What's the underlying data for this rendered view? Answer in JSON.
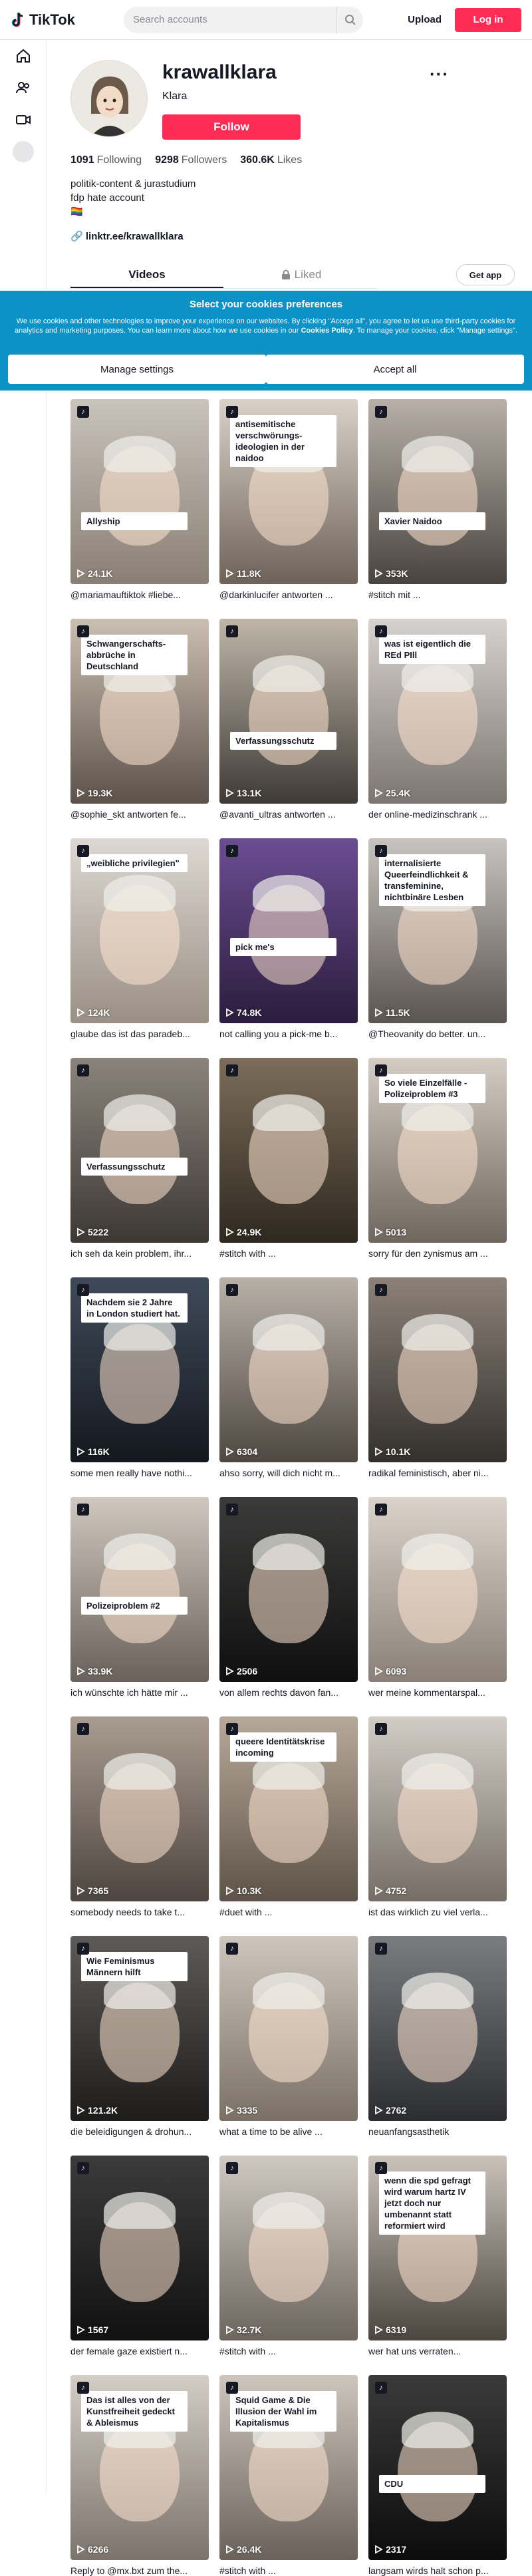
{
  "header": {
    "logo_text": "TikTok",
    "search_placeholder": "Search accounts",
    "upload_label": "Upload",
    "login_label": "Log in",
    "accent_color": "#fe2c55"
  },
  "sidebar": {
    "icons": [
      "home-icon",
      "following-icon",
      "live-icon",
      "profile-circle"
    ]
  },
  "profile": {
    "username": "krawallklara",
    "nickname": "Klara",
    "follow_label": "Follow",
    "more_label": "···",
    "following_count": "1091",
    "following_label": "Following",
    "followers_count": "9298",
    "followers_label": "Followers",
    "likes_count": "360.6K",
    "likes_label": "Likes",
    "bio_line1": "politik-content & jurastudium",
    "bio_line2": "fdp hate account",
    "bio_line3": "🏳️‍🌈",
    "link": "linktr.ee/krawallklara"
  },
  "tabs": {
    "videos": "Videos",
    "liked": "Liked",
    "get_app": "Get app"
  },
  "cookie": {
    "title": "Select your cookies preferences",
    "text_before": "We use cookies and other technologies to improve your experience on our websites. By clicking \"Accept all\", you agree to let us use third-party cookies for analytics and marketing purposes. You can learn more about how we use cookies in our ",
    "policy_link": "Cookies Policy",
    "text_after": ". To manage your cookies, click \"Manage settings\".",
    "manage_label": "Manage settings",
    "accept_label": "Accept all",
    "bg_color": "#0d92c7"
  },
  "videos": [
    {
      "views": "24.1K",
      "overlay": "Allyship",
      "caption": "@mariamauftiktok #liebe..."
    },
    {
      "views": "11.8K",
      "overlay": "antisemitische verschwörungs-ideologien in der naidoo",
      "caption": "@darkinlucifer antworten ..."
    },
    {
      "views": "353K",
      "overlay": "Xavier Naidoo",
      "caption": "#stitch mit ..."
    },
    {
      "views": "19.3K",
      "overlay": "Schwangerschafts-abbrüche in Deutschland",
      "caption": "@sophie_skt antworten fe..."
    },
    {
      "views": "13.1K",
      "overlay": "Verfassungsschutz",
      "caption": "@avanti_ultras antworten ..."
    },
    {
      "views": "25.4K",
      "overlay": "was ist eigentlich die REd PIll",
      "caption": "der online-medizinschrank ..."
    },
    {
      "views": "124K",
      "overlay": "„weibliche privilegien\"",
      "caption": "glaube das ist das paradeb..."
    },
    {
      "views": "74.8K",
      "overlay": "pick me's",
      "caption": "not calling you a pick-me b..."
    },
    {
      "views": "11.5K",
      "overlay": "internalisierte Queerfeindlichkeit & transfeminine, nichtbinäre Lesben",
      "caption": "@Theovanity do better. un..."
    },
    {
      "views": "5222",
      "overlay": "Verfassungsschutz",
      "caption": "ich seh da kein problem, ihr..."
    },
    {
      "views": "24.9K",
      "overlay": "",
      "caption": "#stitch with ..."
    },
    {
      "views": "5013",
      "overlay": "So viele Einzelfälle - Polizeiproblem #3",
      "caption": "sorry für den zynismus am ..."
    },
    {
      "views": "116K",
      "overlay": "Nachdem sie 2 Jahre in London studiert hat.",
      "caption": "some men really have nothi..."
    },
    {
      "views": "6304",
      "overlay": "",
      "caption": "ahso sorry, will dich nicht m..."
    },
    {
      "views": "10.1K",
      "overlay": "",
      "caption": "radikal feministisch, aber ni..."
    },
    {
      "views": "33.9K",
      "overlay": "Polizeiproblem #2",
      "caption": "ich wünschte ich hätte mir ..."
    },
    {
      "views": "2506",
      "overlay": "",
      "caption": "von allem rechts davon fan..."
    },
    {
      "views": "6093",
      "overlay": "",
      "caption": "wer meine kommentarspal..."
    },
    {
      "views": "7365",
      "overlay": "",
      "caption": "somebody needs to take t..."
    },
    {
      "views": "10.3K",
      "overlay": "queere Identitätskrise incoming",
      "caption": "#duet with ..."
    },
    {
      "views": "4752",
      "overlay": "",
      "caption": "ist das wirklich zu viel verla..."
    },
    {
      "views": "121.2K",
      "overlay": "Wie Feminismus Männern hilft",
      "caption": "die beleidigungen & drohun..."
    },
    {
      "views": "3335",
      "overlay": "",
      "caption": "what a time to be alive ..."
    },
    {
      "views": "2762",
      "overlay": "",
      "caption": "neuanfangsasthetik"
    },
    {
      "views": "1567",
      "overlay": "",
      "caption": "der female gaze existiert n..."
    },
    {
      "views": "32.7K",
      "overlay": "",
      "caption": "#stitch with ..."
    },
    {
      "views": "6319",
      "overlay": "wenn die spd gefragt wird warum hartz IV jetzt doch nur umbenannt statt reformiert wird",
      "caption": "wer hat uns verraten..."
    },
    {
      "views": "6266",
      "overlay": "Das ist alles von der Kunstfreiheit gedeckt & Ableismus",
      "caption": "Reply to @mx.bxt zum the..."
    },
    {
      "views": "26.4K",
      "overlay": "Squid Game & Die Illusion der Wahl im Kapitalismus",
      "caption": "#stitch with ..."
    },
    {
      "views": "2317",
      "overlay": "CDU",
      "caption": "langsam wirds halt schon p..."
    }
  ]
}
